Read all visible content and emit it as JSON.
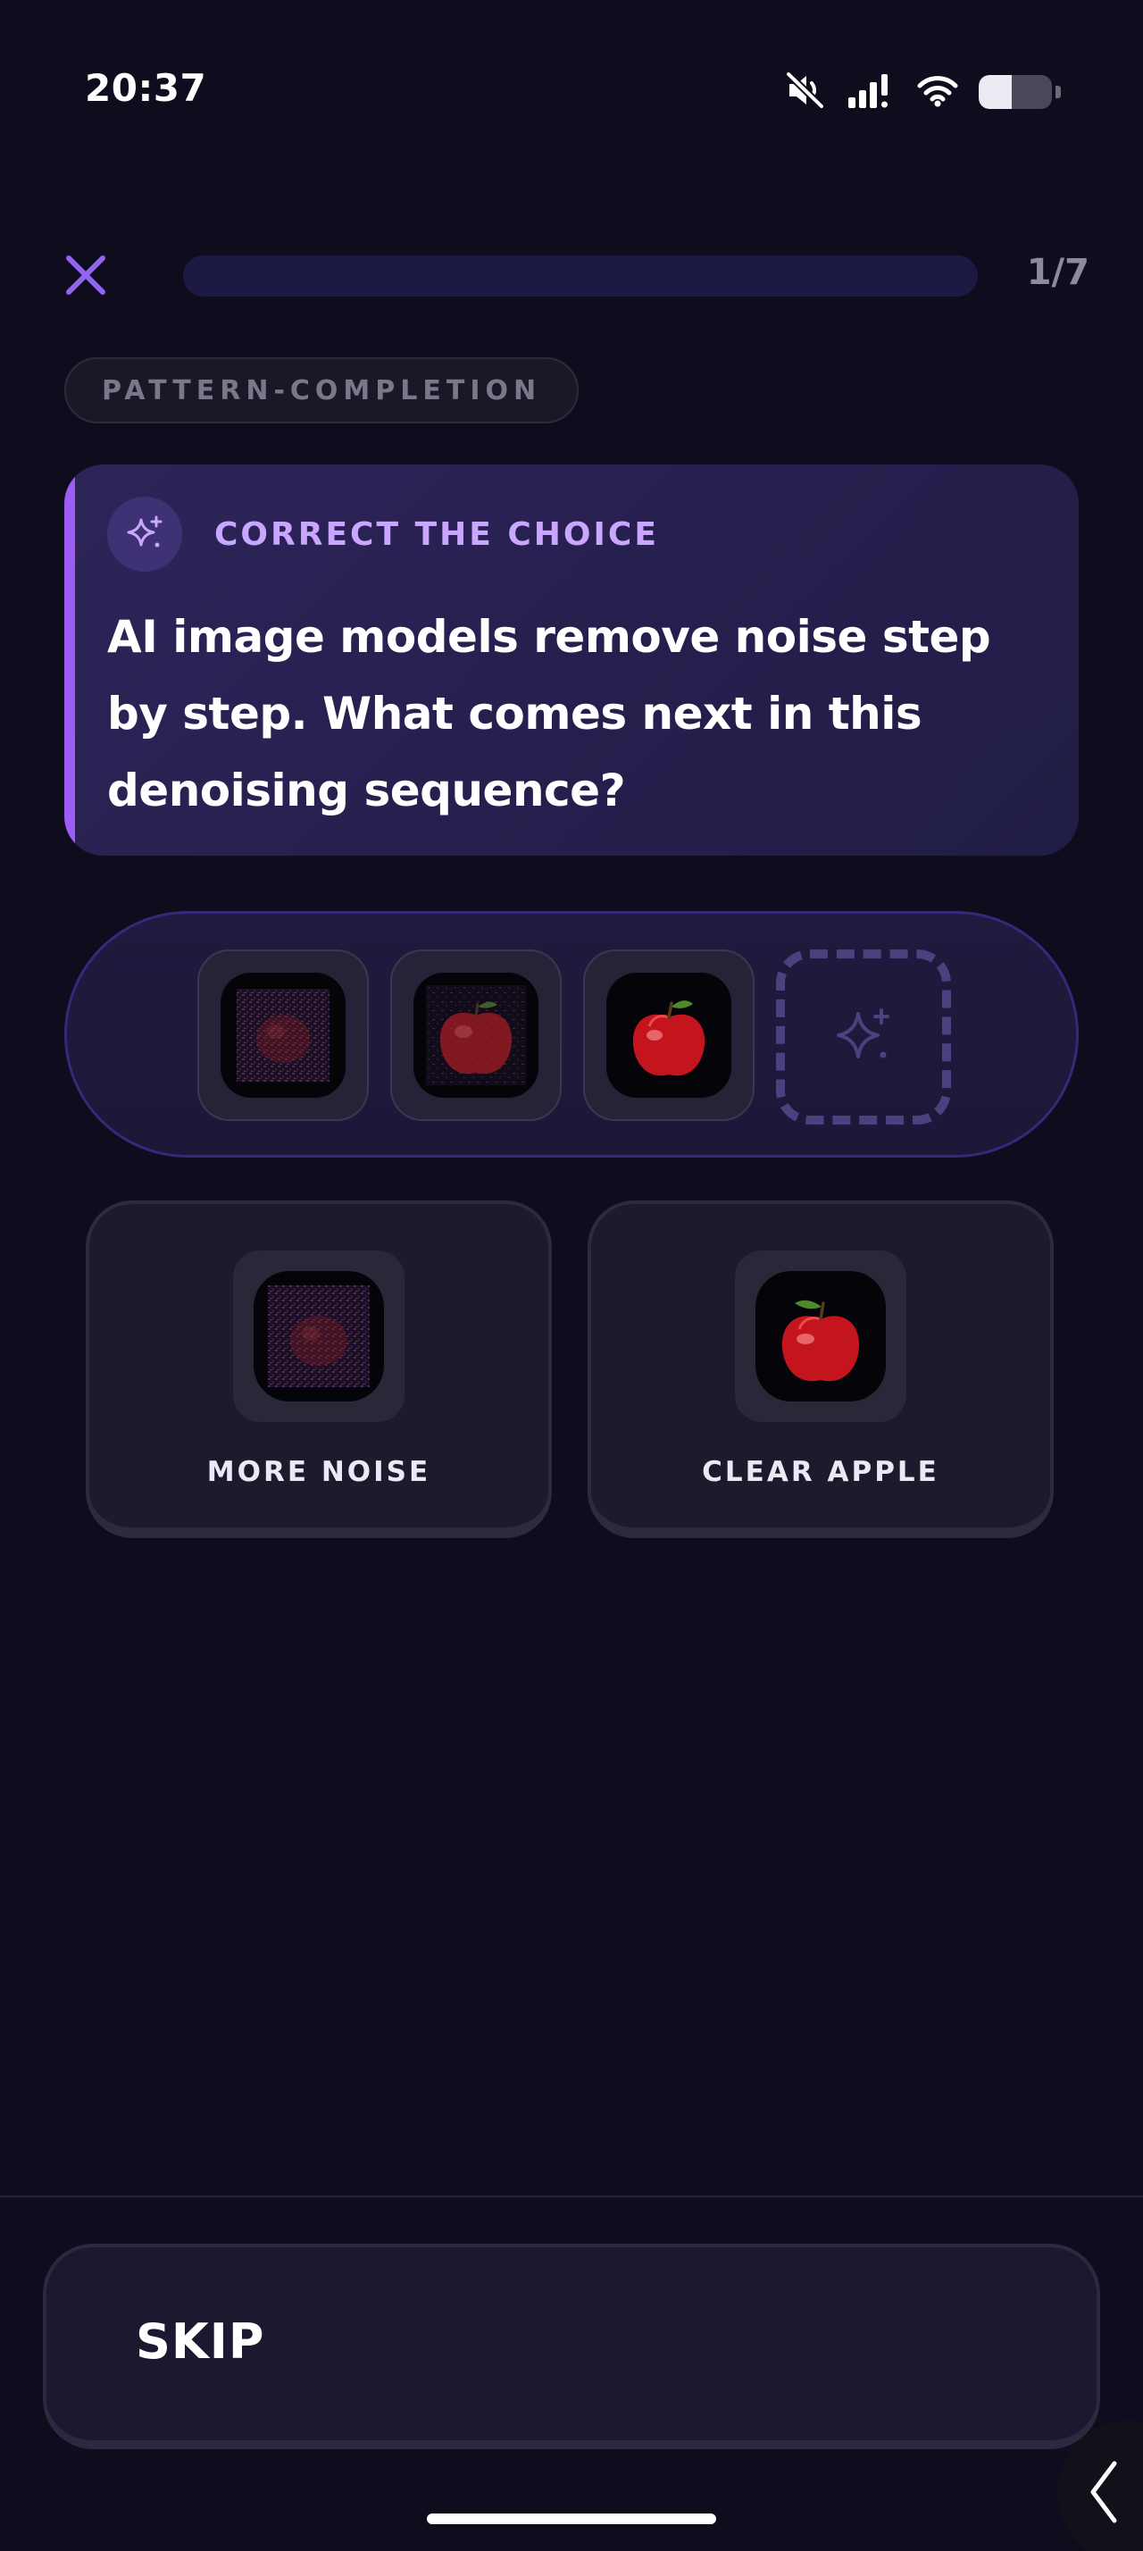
{
  "status_bar": {
    "time": "20:37",
    "icons": [
      "mute-icon",
      "signal-icon",
      "wifi-icon",
      "battery-icon"
    ],
    "battery_level": 0.45
  },
  "header": {
    "close_icon": "close-icon",
    "progress": {
      "current": 1,
      "total": 7,
      "label": "1/7",
      "fraction": 0.0
    }
  },
  "category": {
    "label": "PATTERN-COMPLETION"
  },
  "question": {
    "icon": "sparkle-icon",
    "kicker": "CORRECT THE CHOICE",
    "text": "AI image models remove noise step by step. What comes next in this denoising sequence?"
  },
  "sequence": {
    "items": [
      {
        "image": "very-noisy-apple"
      },
      {
        "image": "slightly-noisy-apple"
      },
      {
        "image": "clear-apple"
      }
    ],
    "slot_icon": "sparkle-icon"
  },
  "options": [
    {
      "label": "MORE NOISE",
      "image": "very-noisy-apple"
    },
    {
      "label": "CLEAR APPLE",
      "image": "clear-apple"
    }
  ],
  "footer": {
    "skip_label": "SKIP"
  },
  "colors": {
    "background": "#0f0c1d",
    "accent": "#9d5cf6",
    "kicker": "#c9a6ff",
    "progress_track": "#1c1a45"
  }
}
